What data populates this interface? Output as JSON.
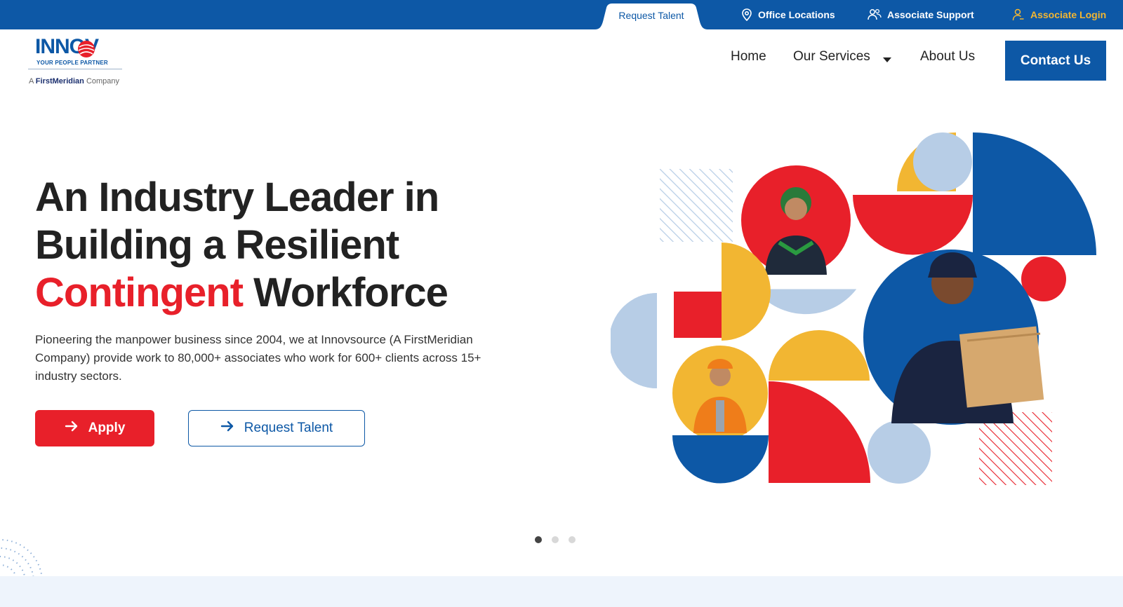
{
  "topbar": {
    "request_talent": "Request Talent",
    "office_locations": "Office Locations",
    "associate_support": "Associate Support",
    "associate_login": "Associate Login"
  },
  "logo": {
    "brand": "INNOV",
    "tagline": "YOUR PEOPLE PARTNER",
    "sub_prefix": "A",
    "sub_first": "FirstMeridian",
    "sub_suffix": "Company"
  },
  "nav": {
    "home": "Home",
    "services": "Our Services",
    "about": "About Us",
    "contact": "Contact Us"
  },
  "hero": {
    "line1": "An Industry Leader in",
    "line2": "Building a Resilient",
    "highlight": "Contingent",
    "line3_rest": " Workforce",
    "description": "Pioneering the manpower business since 2004, we at Innovsource (A FirstMeridian Company) provide work to 80,000+ associates who work for 600+ clients across 15+ industry sectors.",
    "apply": "Apply",
    "request_talent": "Request Talent"
  },
  "carousel": {
    "slides": 3,
    "active": 1
  },
  "colors": {
    "blue": "#0d58a6",
    "red": "#e8202a",
    "yellow": "#f2b632",
    "light_blue": "#b7cde6"
  },
  "icons": [
    "location-pin-icon",
    "people-support-icon",
    "user-login-icon",
    "arrow-right-icon",
    "caret-down-icon"
  ]
}
